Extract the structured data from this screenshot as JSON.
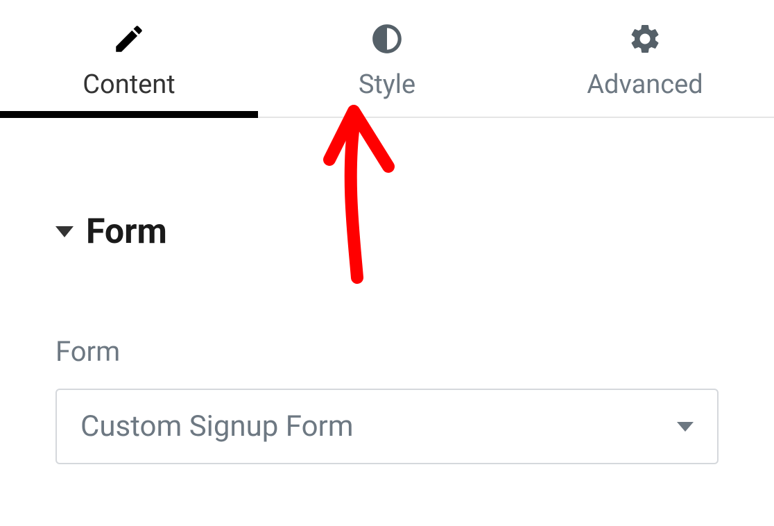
{
  "tabs": {
    "content": {
      "label": "Content"
    },
    "style": {
      "label": "Style"
    },
    "advanced": {
      "label": "Advanced"
    }
  },
  "section": {
    "title": "Form"
  },
  "form": {
    "label": "Form",
    "selected": "Custom Signup Form"
  },
  "colors": {
    "annotation": "#ff0000",
    "icon_inactive": "#556068",
    "icon_active": "#000000",
    "text_muted": "#6d7882"
  }
}
